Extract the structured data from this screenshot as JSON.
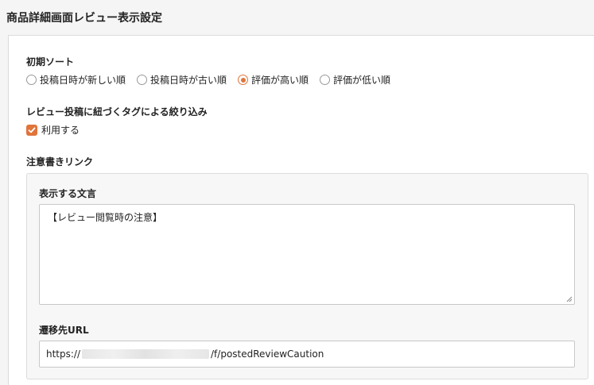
{
  "header": {
    "title": "商品詳細画面レビュー表示設定"
  },
  "initial_sort": {
    "label": "初期ソート",
    "options": [
      {
        "label": "投稿日時が新しい順",
        "checked": false
      },
      {
        "label": "投稿日時が古い順",
        "checked": false
      },
      {
        "label": "評価が高い順",
        "checked": true
      },
      {
        "label": "評価が低い順",
        "checked": false
      }
    ]
  },
  "tag_filter": {
    "label": "レビュー投稿に紐づくタグによる絞り込み",
    "checkbox_label": "利用する",
    "checked": true
  },
  "notice_link": {
    "label": "注意書きリンク",
    "text_label": "表示する文言",
    "text_value": "【レビュー閲覧時の注意】",
    "url_label": "遷移先URL",
    "url_prefix": "https://",
    "url_suffix": "/f/postedReviewCaution"
  },
  "colors": {
    "accent": "#e0743b"
  }
}
